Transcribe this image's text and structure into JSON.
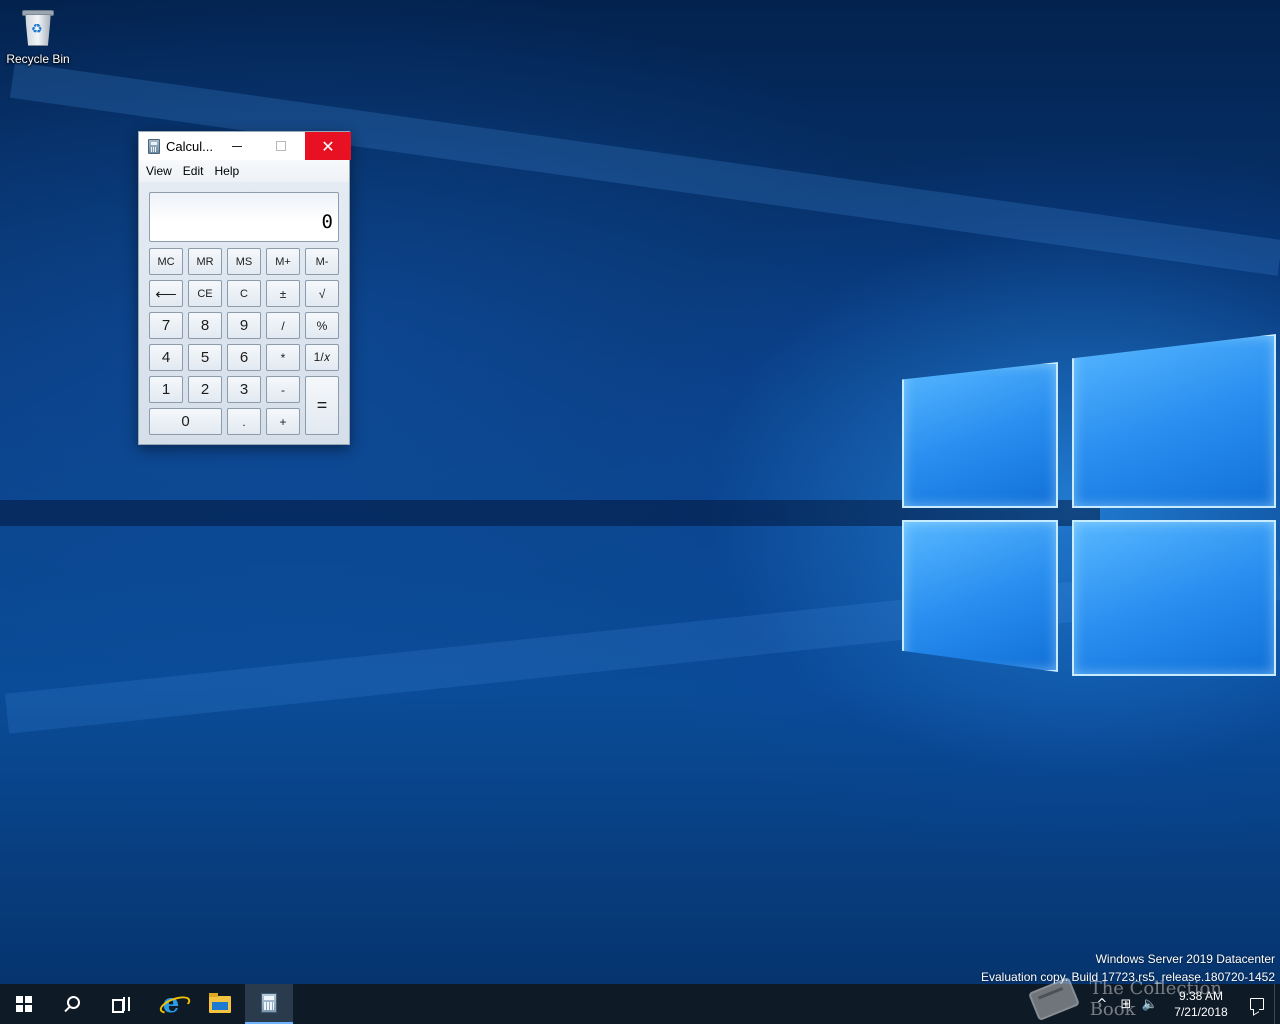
{
  "desktop": {
    "icons": [
      {
        "label": "Recycle Bin",
        "icon": "recycle-bin-icon"
      }
    ],
    "watermark": {
      "edition": "Windows Server 2019 Datacenter",
      "build": "Evaluation copy. Build 17723.rs5_release.180720-1452"
    },
    "brand_overlay": "The Collection Book"
  },
  "calculator": {
    "title": "Calcul...",
    "menu": [
      "View",
      "Edit",
      "Help"
    ],
    "display": "0",
    "keys": {
      "mc": "MC",
      "mr": "MR",
      "ms": "MS",
      "mplus": "M+",
      "mminus": "M-",
      "back": "⟵",
      "ce": "CE",
      "c": "C",
      "neg": "±",
      "sqrt": "√",
      "k7": "7",
      "k8": "8",
      "k9": "9",
      "div": "/",
      "pct": "%",
      "k4": "4",
      "k5": "5",
      "k6": "6",
      "mul": "*",
      "recip": "1/𝑥",
      "k1": "1",
      "k2": "2",
      "k3": "3",
      "sub": "-",
      "eq": "=",
      "k0": "0",
      "dot": ".",
      "add": "+"
    },
    "window_controls": {
      "minimize": "─",
      "close": "✕"
    }
  },
  "taskbar": {
    "items": [
      "start-icon",
      "search-icon",
      "task-view-icon",
      "internet-explorer-icon",
      "file-explorer-icon",
      "calculator-icon"
    ],
    "active": "calculator-icon",
    "tray": {
      "chevron": "^",
      "network": "⊞",
      "volume": "🔈",
      "time": "9:38 AM",
      "date": "7/21/2018"
    }
  },
  "colors": {
    "close_button": "#e81123",
    "taskbar": "#0f1a27",
    "accent": "#6fb3ff"
  }
}
